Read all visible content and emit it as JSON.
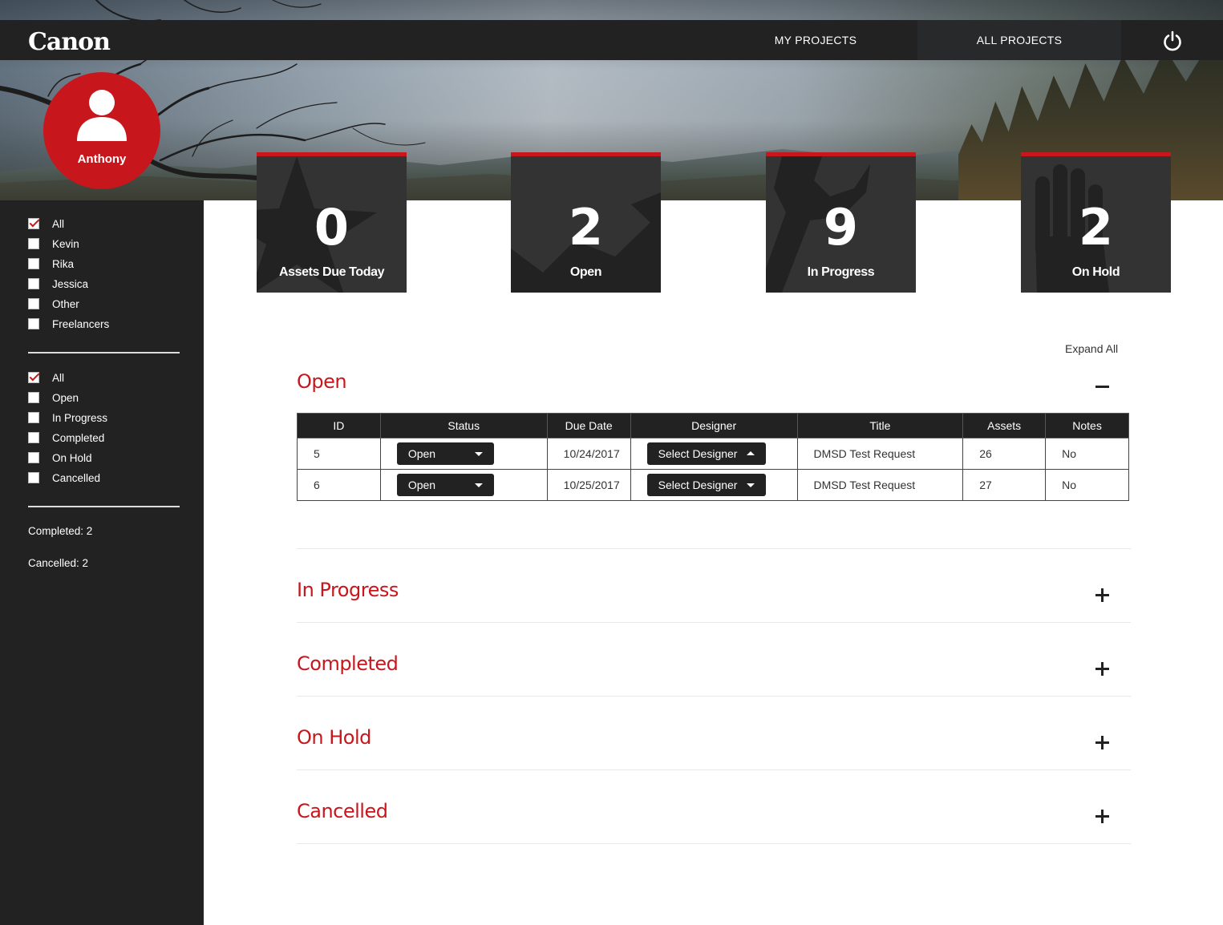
{
  "header": {
    "logo": "Canon",
    "nav": [
      {
        "label": "MY PROJECTS"
      },
      {
        "label": "ALL PROJECTS"
      }
    ],
    "power_icon": "power-icon"
  },
  "user": {
    "name": "Anthony",
    "icon": "user-icon"
  },
  "filters": {
    "people": [
      {
        "label": "All",
        "checked": true
      },
      {
        "label": "Kevin",
        "checked": false
      },
      {
        "label": "Rika",
        "checked": false
      },
      {
        "label": "Jessica",
        "checked": false
      },
      {
        "label": "Other",
        "checked": false
      },
      {
        "label": "Freelancers",
        "checked": false
      }
    ],
    "statuses": [
      {
        "label": "All",
        "checked": true
      },
      {
        "label": "Open",
        "checked": false
      },
      {
        "label": "In Progress",
        "checked": false
      },
      {
        "label": "Completed",
        "checked": false
      },
      {
        "label": "On Hold",
        "checked": false
      },
      {
        "label": "Cancelled",
        "checked": false
      }
    ],
    "stats": [
      "Completed: 2",
      "Cancelled: 2"
    ]
  },
  "cards": [
    {
      "value": "0",
      "label": "Assets Due Today",
      "icon": "star-icon"
    },
    {
      "value": "2",
      "label": "Open",
      "icon": "chart-arrow-icon"
    },
    {
      "value": "9",
      "label": "In Progress",
      "icon": "wrench-icon"
    },
    {
      "value": "2",
      "label": "On Hold",
      "icon": "hand-icon"
    }
  ],
  "main": {
    "expand_all": "Expand All",
    "sections": [
      {
        "title": "Open",
        "expanded": true
      },
      {
        "title": "In Progress",
        "expanded": false
      },
      {
        "title": "Completed",
        "expanded": false
      },
      {
        "title": "On Hold",
        "expanded": false
      },
      {
        "title": "Cancelled",
        "expanded": false
      }
    ],
    "table": {
      "columns": [
        "ID",
        "Status",
        "Due Date",
        "Designer",
        "Title",
        "Assets",
        "Notes"
      ],
      "rows": [
        {
          "id": "5",
          "status": "Open",
          "due": "10/24/2017",
          "designer": "Select Designer",
          "title": "DMSD Test Request",
          "assets": "26",
          "notes": "No"
        },
        {
          "id": "6",
          "status": "Open",
          "due": "10/25/2017",
          "designer": "Select Designer",
          "title": "DMSD Test Request",
          "assets": "27",
          "notes": "No"
        }
      ]
    }
  },
  "colors": {
    "accent": "#c8161d",
    "dark": "#222222",
    "card": "#333333"
  }
}
